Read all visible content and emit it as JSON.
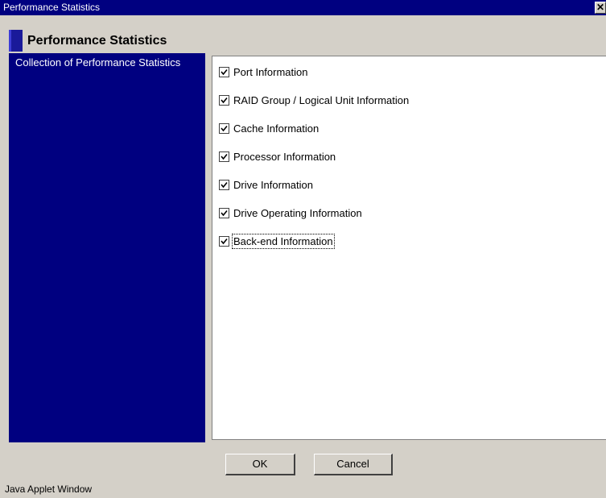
{
  "window": {
    "title": "Performance Statistics",
    "close_glyph": "✕"
  },
  "header": {
    "title": "Performance Statistics"
  },
  "sidebar": {
    "item": "Collection of Performance Statistics"
  },
  "checkboxes": [
    {
      "label": "Port Information",
      "checked": true
    },
    {
      "label": "RAID Group / Logical Unit Information",
      "checked": true
    },
    {
      "label": "Cache Information",
      "checked": true
    },
    {
      "label": "Processor Information",
      "checked": true
    },
    {
      "label": "Drive Information",
      "checked": true
    },
    {
      "label": "Drive Operating Information",
      "checked": true
    },
    {
      "label": "Back-end Information",
      "checked": true
    }
  ],
  "buttons": {
    "ok": "OK",
    "cancel": "Cancel"
  },
  "status": {
    "text": "Java Applet Window"
  },
  "colors": {
    "titlebar": "#000080",
    "sidebar": "#000080",
    "background": "#d4d0c8"
  }
}
